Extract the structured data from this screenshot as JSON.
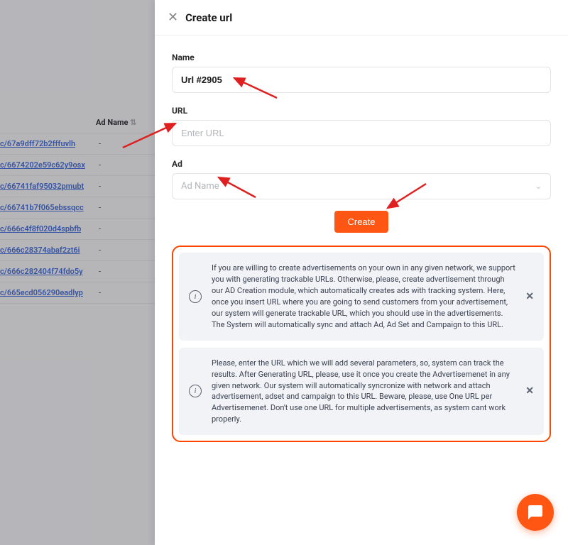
{
  "drawer": {
    "title": "Create url",
    "name_label": "Name",
    "name_value": "Url #2905",
    "url_label": "URL",
    "url_placeholder": "Enter URL",
    "ad_label": "Ad",
    "ad_placeholder": "Ad Name",
    "create_button": "Create"
  },
  "alerts": [
    "If you are willing to create advertisements on your own in any given network, we support you with generating trackable URLs. Otherwise, please, create advertisement through our AD Creation module, which automatically creates ads with tracking system. Here, once you insert URL where you are going to send customers from your advertisement, our system will generate trackable URL, which you should use in the advertisements. The System will automatically sync and attach Ad, Ad Set and Campaign to this URL.",
    "Please, enter the URL which we will add several parameters, so, system can track the results. After Generating URL, please, use it once you create the Advertisemenet in any given network. Our system will automatically syncronize with network and attach advertisement, adset and campaign to this URL. Beware, please, use One URL per Advertisemenet. Don't use one URL for multiple advertisements, as system cant work properly."
  ],
  "bg": {
    "column": "Ad Name",
    "rows": [
      "c/67a9dff72b2fffuvlh",
      "c/6674202e59c62y9osx",
      "c/66741faf95032pmubt",
      "c/66741b7f065ebssqcc",
      "c/666c4f8f020d4spbfb",
      "c/666c28374abaf2zt6i",
      "c/666c282404f74fdo5y",
      "c/665ecd056290eadlyp"
    ]
  }
}
